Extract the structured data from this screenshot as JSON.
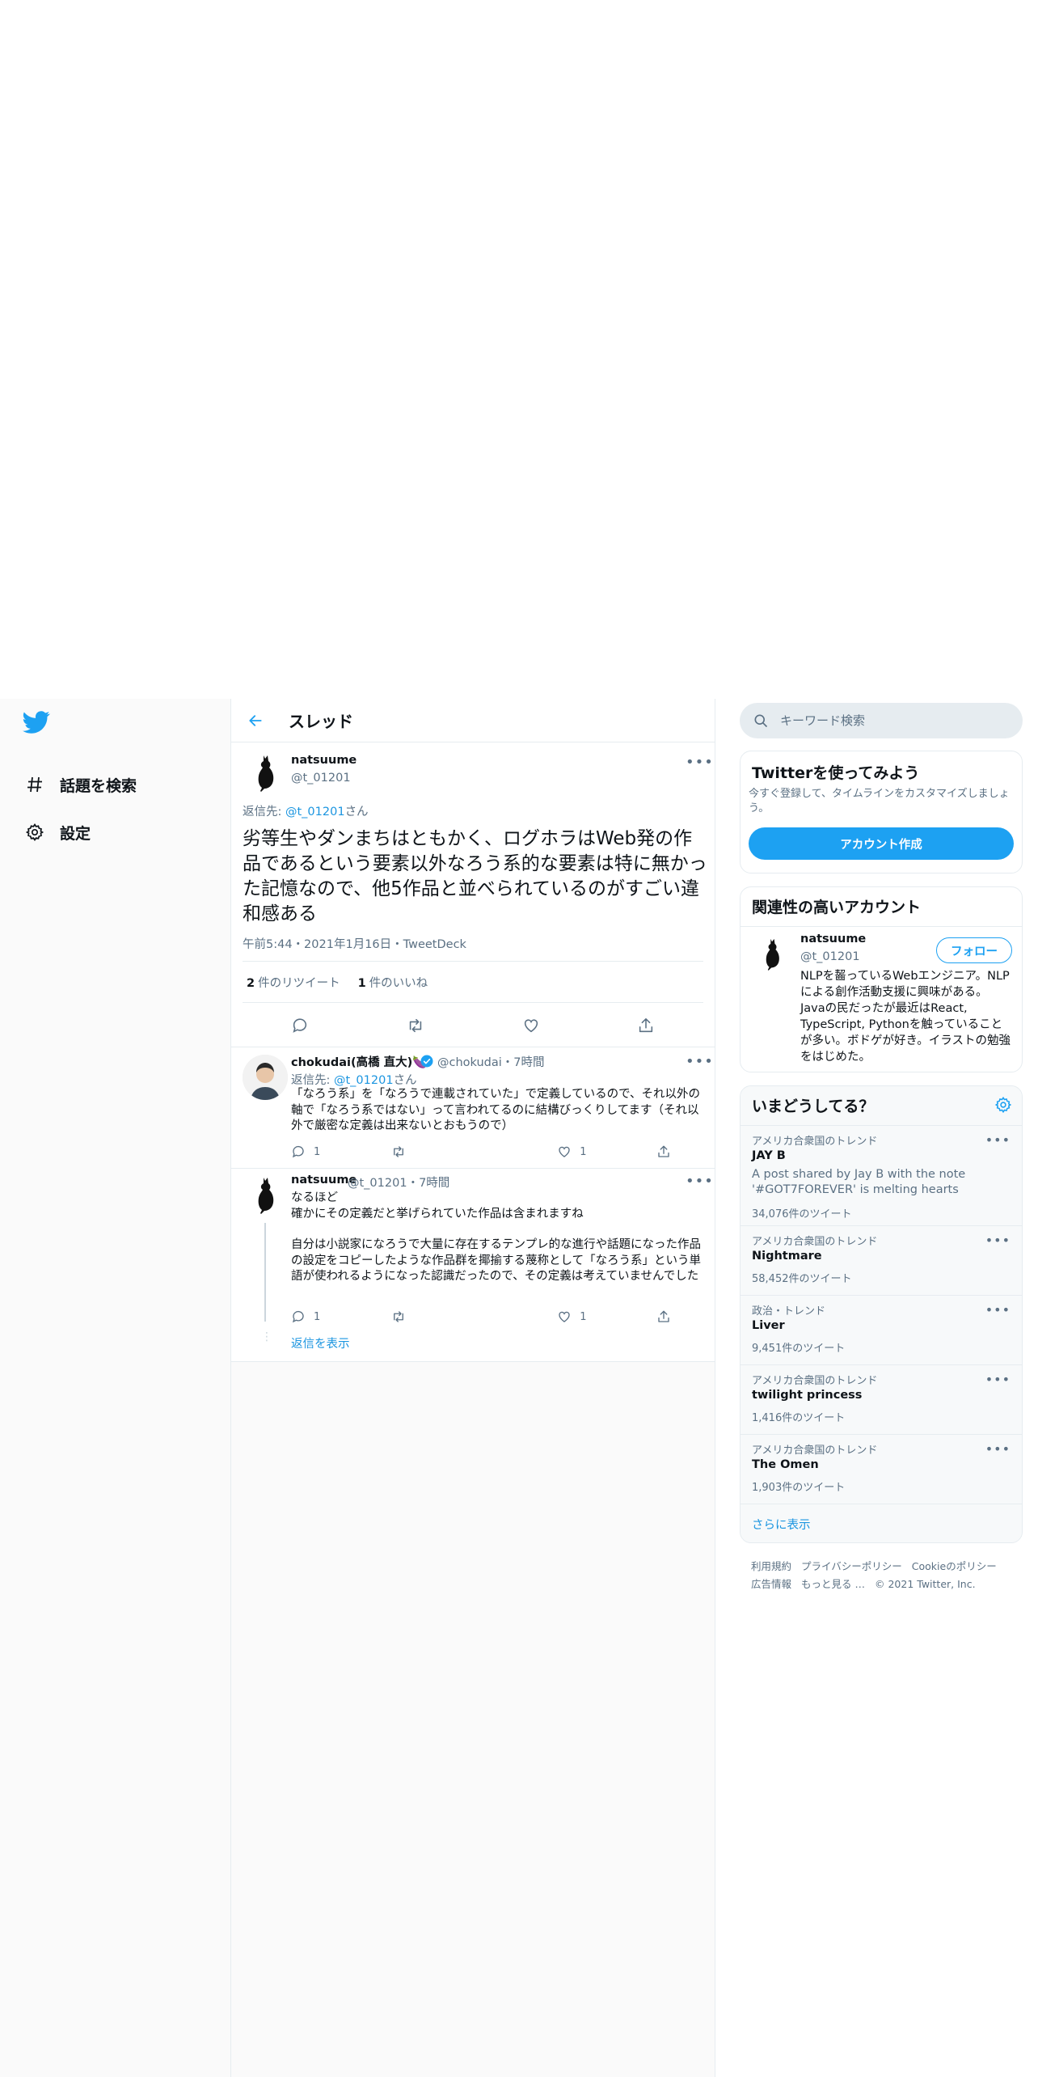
{
  "nav": {
    "logo_icon": "twitter-bird-icon",
    "items": [
      {
        "label": "話題を検索",
        "icon": "hashtag-icon"
      },
      {
        "label": "設定",
        "icon": "gear-icon"
      }
    ]
  },
  "header": {
    "title": "スレッド",
    "back_icon": "arrow-left-icon"
  },
  "main_tweet": {
    "name": "natsuume",
    "handle": "@t_01201",
    "reply_prefix": "返信先: ",
    "reply_handle": "@t_01201",
    "reply_suffix": "さん",
    "text": "劣等生やダンまちはともかく、ログホラはWeb発の作品であるという要素以外なろう系的な要素は特に無かった記憶なので、他5作品と並べられているのがすごい違和感ある",
    "meta": "午前5:44・2021年1月16日・TweetDeck",
    "retweets": "2",
    "retweets_label": "件のリツイート",
    "likes": "1",
    "likes_label": "件のいいね"
  },
  "replies": [
    {
      "name": "chokudai(高橋 直大)🍆",
      "handle": "@chokudai",
      "time": "7時間",
      "verified": true,
      "reply_prefix": "返信先: ",
      "reply_handle": "@t_01201",
      "reply_suffix": "さん",
      "text": "「なろう系」を「なろうで連載されていた」で定義しているので、それ以外の軸で「なろう系ではない」って言われてるのに結構びっくりしてます（それ以外で厳密な定義は出来ないとおもうので）",
      "reply_count": "1",
      "like_count": "1"
    },
    {
      "name": "natsuume",
      "handle": "@t_01201",
      "time": "7時間",
      "text_1": "なるほど",
      "text_2": "確かにその定義だと挙げられていた作品は含まれますね",
      "text_3": "自分は小説家になろうで大量に存在するテンプレ的な進行や話題になった作品の設定をコピーしたような作品群を揶揄する蔑称として「なろう系」という単語が使われるようになった認識だったので、その定義は考えていませんでした",
      "reply_count": "1",
      "like_count": "1"
    }
  ],
  "show_replies": "返信を表示",
  "search": {
    "placeholder": "キーワード検索"
  },
  "signup_card": {
    "title": "Twitterを使ってみよう",
    "desc": "今すぐ登録して、タイムラインをカスタマイズしましょう。",
    "button": "アカウント作成"
  },
  "related_card": {
    "title": "関連性の高いアカウント",
    "name": "natsuume",
    "handle": "@t_01201",
    "follow": "フォロー",
    "bio": "NLPを齧っているWebエンジニア。NLPによる創作活動支援に興味がある。Javaの民だったが最近はReact, TypeScript, Pythonを触っていることが多い。ボドゲが好き。イラストの勉強をはじめた。"
  },
  "trends_card": {
    "title": "いまどうしてる？",
    "settings_icon": "gear-icon",
    "items": [
      {
        "context": "アメリカ合衆国のトレンド",
        "name": "JAY B",
        "desc": "A post shared by Jay B with the note '#GOT7FOREVER' is melting hearts",
        "count": "34,076件のツイート"
      },
      {
        "context": "アメリカ合衆国のトレンド",
        "name": "Nightmare",
        "desc": "",
        "count": "58,452件のツイート"
      },
      {
        "context": "政治・トレンド",
        "name": "Liver",
        "desc": "",
        "count": "9,451件のツイート"
      },
      {
        "context": "アメリカ合衆国のトレンド",
        "name": "twilight princess",
        "desc": "",
        "count": "1,416件のツイート"
      },
      {
        "context": "アメリカ合衆国のトレンド",
        "name": "The Omen",
        "desc": "",
        "count": "1,903件のツイート"
      }
    ],
    "show_more": "さらに表示"
  },
  "footer": {
    "links_row1": [
      "利用規約",
      "プライバシーポリシー",
      "Cookieのポリシー"
    ],
    "links_row2": [
      "広告情報",
      "もっと見る …"
    ],
    "copyright": "© 2021 Twitter, Inc."
  },
  "colors": {
    "accent": "#1da1f2",
    "link": "#1b95e0",
    "muted": "#5b7083",
    "border": "#e6ecf0"
  }
}
